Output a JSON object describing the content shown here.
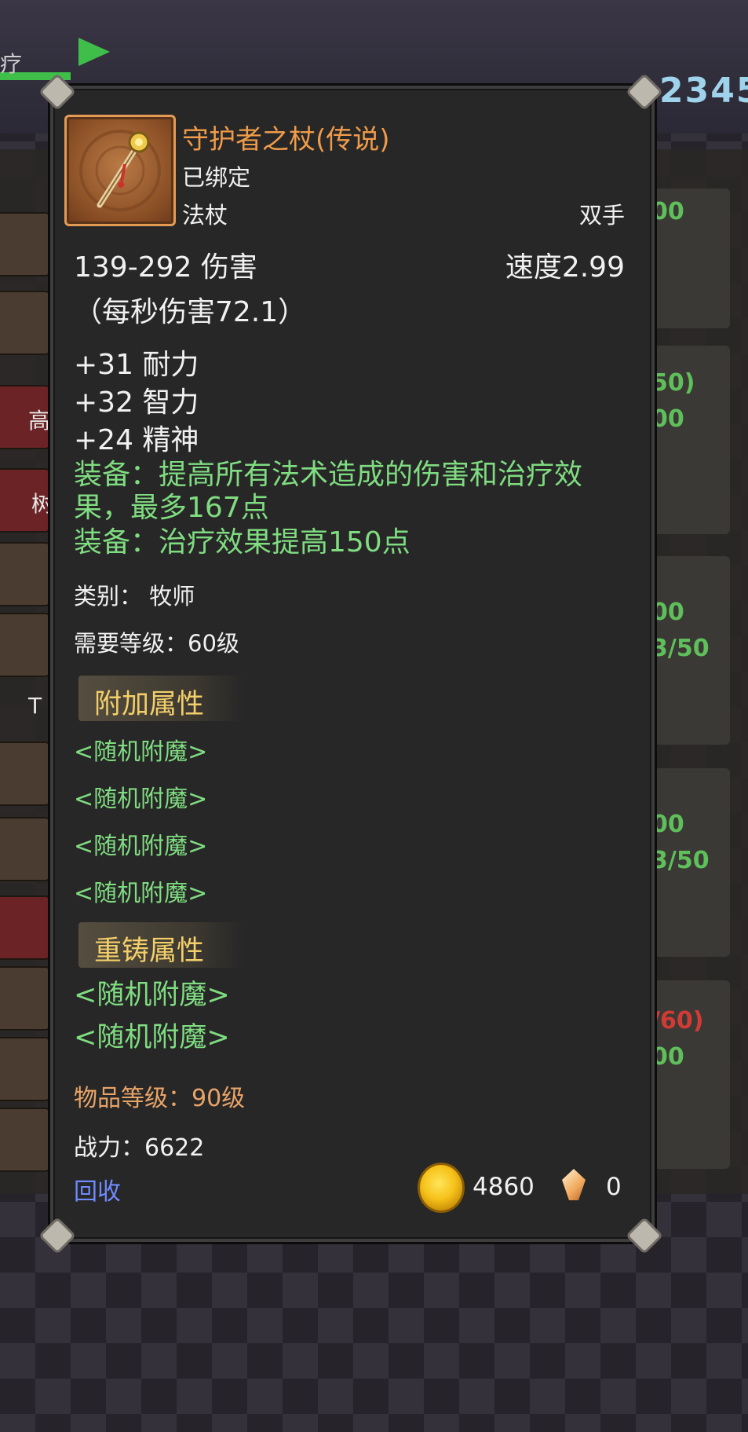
{
  "item": {
    "name": "守护者之杖(传说)",
    "binding": "已绑定",
    "type": "法杖",
    "hand": "双手",
    "damage": "139-292 伤害",
    "speed": "速度2.99",
    "dps": "（每秒伤害72.1）",
    "stats": [
      "+31 耐力",
      "+32 智力",
      "+24 精神"
    ],
    "equip_effects": [
      "装备：提高所有法术造成的伤害和治疗效",
      "果，最多167点",
      "装备：治疗效果提高150点"
    ],
    "class_label": "类别：  牧师",
    "required_level": "需要等级：60级",
    "bonus_section": {
      "label": "附加属性",
      "entries": [
        "<随机附魔>",
        "<随机附魔>",
        "<随机附魔>",
        "<随机附魔>"
      ]
    },
    "reforge_section": {
      "label": "重铸属性",
      "entries": [
        "<随机附魔>",
        "<随机附魔>"
      ]
    },
    "item_level": "物品等级：90级",
    "combat_power": "战力：6622"
  },
  "actions": {
    "recycle_label": "回收"
  },
  "prices": {
    "gold": "4860",
    "gems": "0"
  },
  "background": {
    "right_texts": [
      "00",
      "50)",
      "00",
      "00",
      "3/50",
      "00",
      "3/50",
      "/60)",
      "00"
    ],
    "left_texts": [
      "高",
      "树",
      "T"
    ],
    "top_right": "2345",
    "top_left": "疗"
  },
  "colors": {
    "legendary": "#ef9b4a",
    "equip_green": "#7fdc80",
    "section_gold": "#f3cf6a",
    "recycle_blue": "#6f8bff"
  }
}
